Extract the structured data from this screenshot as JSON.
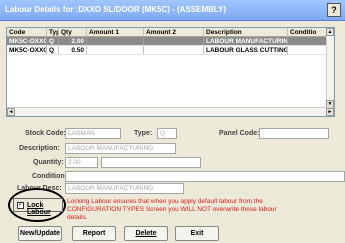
{
  "window": {
    "title": "Labour Details for :DXXO SL/DOOR (MK5C) - (ASSEMBLY)",
    "help_label": "?"
  },
  "grid": {
    "columns": [
      "Code",
      "Type",
      "Qty",
      "Amount 1",
      "Amount 2",
      "Description",
      "Conditio"
    ],
    "rows": [
      {
        "code": "MK5C-OXXO",
        "type": "Q",
        "qty": "2.00",
        "amount1": "",
        "amount2": "",
        "description": "LABOUR MANUFACTURING",
        "condition": ""
      },
      {
        "code": "MK5C-OXXO",
        "type": "Q",
        "qty": "0.50",
        "amount1": "",
        "amount2": "",
        "description": "LABOUR GLASS CUTTING",
        "condition": ""
      }
    ]
  },
  "form": {
    "stock_code_label": "Stock Code:",
    "stock_code_value": "LABMAN",
    "type_label": "Type:",
    "type_value": "Q",
    "panel_code_label": "Panel Code:",
    "panel_code_value": "",
    "description_label": "Description:",
    "description_value": "LABOUR MANUFACTURING",
    "quantity_label": "Quantity:",
    "quantity_value": "2.00",
    "quantity_extra_value": "",
    "condition_label": "Condition:",
    "condition_value": "",
    "labour_desc_label": "Labour Desc:",
    "labour_desc_value": "LABOUR MANUFACTURING"
  },
  "lock": {
    "label": "Lock Labour",
    "checked_mark": "✓",
    "note": "Locking Labour ensures that when you apply default labour from the CONFIGURATION TYPES Screen you WILL NOT overwrite these labour details."
  },
  "buttons": {
    "new_update": "New/Update",
    "report": "Report",
    "delete": "Delete",
    "exit": "Exit"
  },
  "icons": {
    "scroll_up": "▲",
    "scroll_down": "▼",
    "scroll_left": "◄",
    "scroll_right": "►"
  }
}
